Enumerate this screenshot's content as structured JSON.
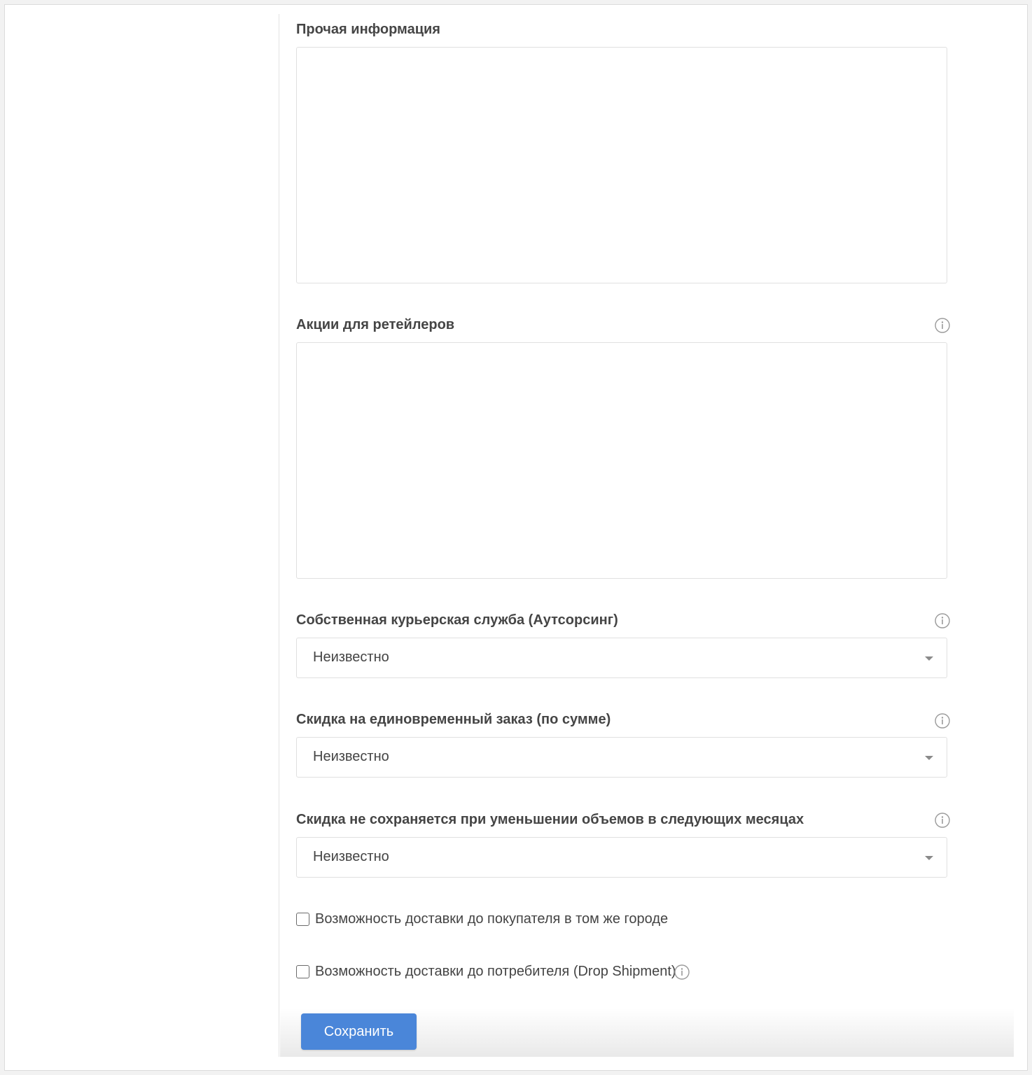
{
  "form": {
    "other_info": {
      "label": "Прочая информация",
      "value": ""
    },
    "retailer_promos": {
      "label": "Акции для ретейлеров",
      "value": ""
    },
    "courier_service": {
      "label": "Собственная курьерская служба (Аутсорсинг)",
      "selected": "Неизвестно"
    },
    "one_time_discount": {
      "label": "Скидка на единовременный заказ (по сумме)",
      "selected": "Неизвестно"
    },
    "discount_not_kept": {
      "label": "Скидка не сохраняется при уменьшении объемов в следующих месяцах",
      "selected": "Неизвестно"
    },
    "same_city_delivery": {
      "label": "Возможность доставки до покупателя в том же городе",
      "checked": false
    },
    "drop_shipment": {
      "label": "Возможность доставки до потребителя (Drop Shipment)",
      "checked": false
    },
    "save_label": "Сохранить"
  },
  "colors": {
    "accent": "#4a86d9",
    "border": "#e0e0e0",
    "label_text": "#454545"
  },
  "icons": {
    "info": "info-icon",
    "select_caret": "chevron-down-icon"
  }
}
